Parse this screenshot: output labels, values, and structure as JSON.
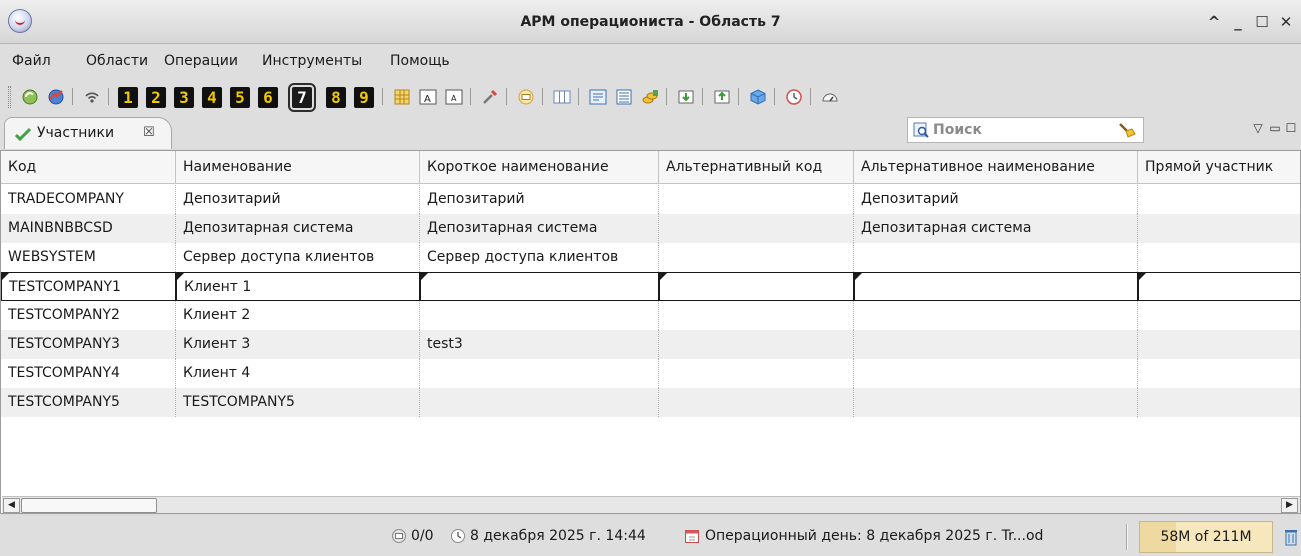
{
  "window": {
    "title": "АРМ операциониста - Область 7",
    "controls": {
      "collapse": "^",
      "minimize": "_",
      "maximize": "☐",
      "close": "✕"
    }
  },
  "menu": {
    "items": [
      "Файл",
      "Области",
      "Операции",
      "Инструменты",
      "Помощь"
    ]
  },
  "toolbar": {
    "area_numbers": [
      "1",
      "2",
      "3",
      "4",
      "5",
      "6",
      "7",
      "8",
      "9"
    ],
    "active_area": "7"
  },
  "view": {
    "tab_label": "Участники",
    "tab_close": "☒",
    "search_placeholder": "Поиск",
    "view_menu": "▽",
    "view_minimize": "▭",
    "view_maximize": "☐"
  },
  "table": {
    "columns": [
      "Код",
      "Наименование",
      "Короткое наименование",
      "Альтернативный код",
      "Альтернативное наименование",
      "Прямой участник"
    ],
    "rows": [
      [
        "TRADECOMPANY",
        "Депозитарий",
        "Депозитарий",
        "",
        "Депозитарий",
        ""
      ],
      [
        "MAINBNBBCSD",
        "Депозитарная система",
        "Депозитарная система",
        "",
        "Депозитарная система",
        ""
      ],
      [
        "WEBSYSTEM",
        "Сервер доступа клиентов",
        "Сервер доступа клиентов",
        "",
        "",
        ""
      ],
      [
        "TESTCOMPANY1",
        "Клиент 1",
        "",
        "",
        "",
        ""
      ],
      [
        "TESTCOMPANY2",
        "Клиент 2",
        "",
        "",
        "",
        ""
      ],
      [
        "TESTCOMPANY3",
        "Клиент 3",
        "test3",
        "",
        "",
        ""
      ],
      [
        "TESTCOMPANY4",
        "Клиент 4",
        "",
        "",
        "",
        ""
      ],
      [
        "TESTCOMPANY5",
        "TESTCOMPANY5",
        "",
        "",
        "",
        ""
      ]
    ],
    "selected_row": 3
  },
  "scrollbar": {
    "left_arrow": "◀",
    "right_arrow": "▶"
  },
  "status": {
    "messages": "0/0",
    "datetime": "8 декабря 2025 г. 14:44",
    "operday": "Операционный день: 8 декабря 2025 г.  Tr...od",
    "memory": "58M of 211M",
    "memory_used_fraction": 0.27
  },
  "colors": {
    "number_button_bg": "#101010",
    "number_button_digit": "#f0c800",
    "memory_bg": "#f6e8bc",
    "row_alt_bg": "#efefef"
  }
}
